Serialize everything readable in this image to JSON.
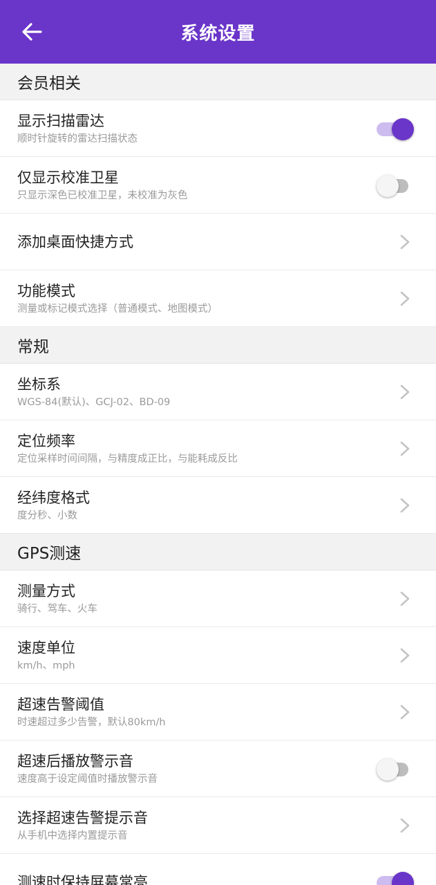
{
  "header": {
    "title": "系统设置"
  },
  "colors": {
    "accent": "#6a35c9",
    "toggle_on_track": "#cdbcf0",
    "toggle_off_track": "#bdbdbd",
    "section_bg": "#f2f2f2"
  },
  "sections": [
    {
      "title": "会员相关",
      "items": [
        {
          "label": "显示扫描雷达",
          "sub": "顺时针旋转的雷达扫描状态",
          "control": "toggle",
          "on": true
        },
        {
          "label": "仅显示校准卫星",
          "sub": "只显示深色已校准卫星，未校准为灰色",
          "control": "toggle",
          "on": false
        },
        {
          "label": "添加桌面快捷方式",
          "control": "chevron"
        },
        {
          "label": "功能模式",
          "sub": "测量或标记模式选择（普通模式、地图模式）",
          "control": "chevron"
        }
      ]
    },
    {
      "title": "常规",
      "items": [
        {
          "label": "坐标系",
          "sub": "WGS-84(默认)、GCJ-02、BD-09",
          "control": "chevron"
        },
        {
          "label": "定位频率",
          "sub": "定位采样时间间隔，与精度成正比，与能耗成反比",
          "control": "chevron"
        },
        {
          "label": "经纬度格式",
          "sub": "度分秒、小数",
          "control": "chevron"
        }
      ]
    },
    {
      "title": "GPS测速",
      "items": [
        {
          "label": "测量方式",
          "sub": "骑行、驾车、火车",
          "control": "chevron"
        },
        {
          "label": "速度单位",
          "sub": "km/h、mph",
          "control": "chevron"
        },
        {
          "label": "超速告警阈值",
          "sub": "时速超过多少告警，默认80km/h",
          "control": "chevron"
        },
        {
          "label": "超速后播放警示音",
          "sub": "速度高于设定阈值时播放警示音",
          "control": "toggle",
          "on": false
        },
        {
          "label": "选择超速告警提示音",
          "sub": "从手机中选择内置提示音",
          "control": "chevron"
        },
        {
          "label": "测速时保持屏幕常亮",
          "control": "toggle",
          "on": true
        }
      ]
    }
  ]
}
